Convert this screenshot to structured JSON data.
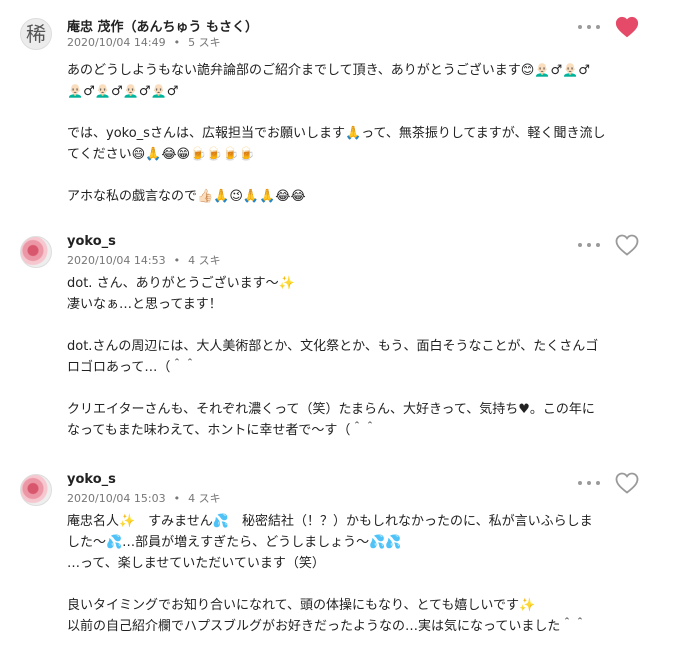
{
  "comments": [
    {
      "author": "庵忠 茂作（あんちゅう もさく）",
      "avatar_char": "稀",
      "date": "2020/10/04 14:49",
      "likes": "5 スキ",
      "liked": true,
      "lines": [
        "あのどうしようもない詭弁論部のご紹介までして頂き、ありがとうございます😊👨🏻‍🦲♂👨🏻‍🦲♂",
        "👨🏻‍🦲♂👨🏻‍🦲♂👨🏻‍🦲♂👨🏻‍🦲♂",
        "",
        "では、yoko_sさんは、広報担当でお願いします🙏って、無茶振りしてますが、軽く聞き流し",
        "てください😄🙏😂😁🍺🍺🍺🍺",
        "",
        "アホな私の戯言なので👍🏻🙏😉🙏🙏😂😂"
      ]
    },
    {
      "author": "yoko_s",
      "date": "2020/10/04 14:53",
      "likes": "4 スキ",
      "liked": false,
      "lines": [
        "dot. さん、ありがとうございます〜✨",
        "凄いなぁ…と思ってます！",
        "",
        "dot.さんの周辺には、大人美術部とか、文化祭とか、もう、面白そうなことが、たくさんゴ",
        "ロゴロあって…（＾＾",
        "",
        "クリエイターさんも、それぞれ濃くって（笑）たまらん、大好きって、気持ち♥。この年に",
        "なってもまた味わえて、ホントに幸せ者で〜す（＾＾"
      ]
    },
    {
      "author": "yoko_s",
      "date": "2020/10/04 15:03",
      "likes": "4 スキ",
      "liked": false,
      "lines": [
        "庵忠名人✨　すみません💦　秘密結社（！？）かもしれなかったのに、私が言いふらしま",
        "した〜💦…部員が増えすぎたら、どうしましょう〜💦💦",
        "…って、楽しませていただいています（笑）",
        "",
        "良いタイミングでお知り合いになれて、頭の体操にもなり、とても嬉しいです✨",
        "以前の自己紹介欄でハプスブルグがお好きだったようなの…実は気になっていました＾＾"
      ]
    }
  ],
  "colors": {
    "heart_liked": "#e54b68",
    "heart_outline": "#9a9a9a",
    "meta_text": "#777777"
  },
  "icons": [
    "more-icon",
    "heart-icon",
    "avatar"
  ]
}
